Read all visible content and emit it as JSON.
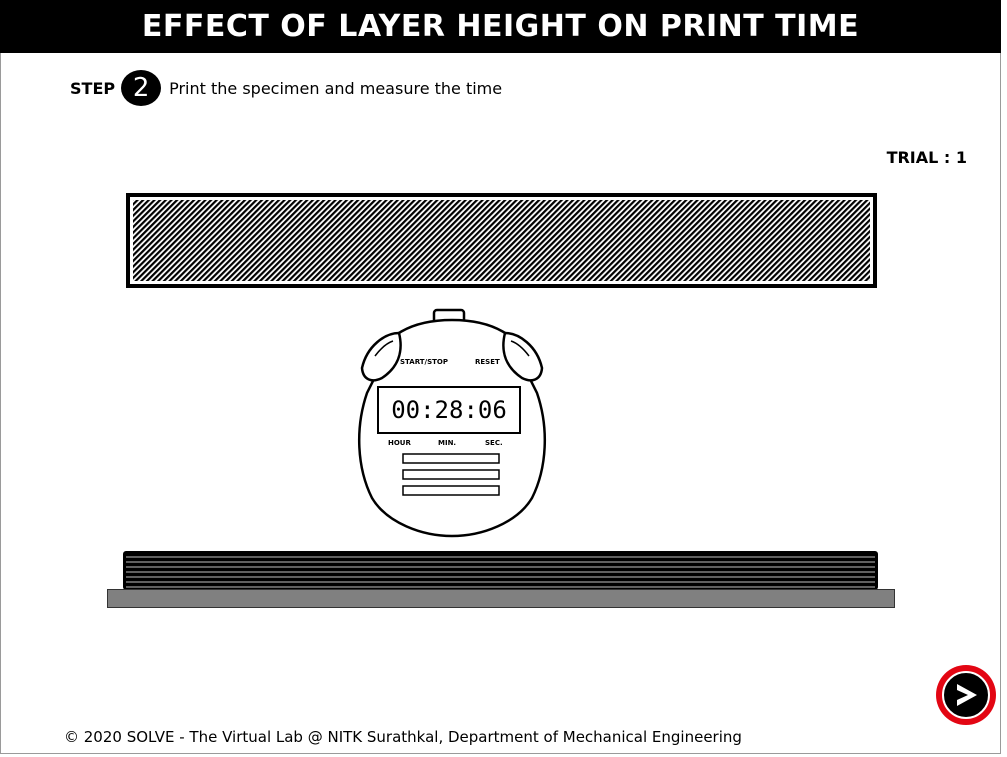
{
  "header": {
    "title": "EFFECT OF LAYER HEIGHT ON PRINT TIME"
  },
  "step": {
    "label": "STEP",
    "number": "2",
    "instruction": "Print the specimen and measure the time"
  },
  "trial": {
    "text": "TRIAL : 1"
  },
  "stopwatch": {
    "start_stop_label": "START/STOP",
    "reset_label": "RESET",
    "time": "00:28:06",
    "hour_label": "HOUR",
    "min_label": "MIN.",
    "sec_label": "SEC."
  },
  "footer": {
    "text": "© 2020 SOLVE - The Virtual Lab @ NITK Surathkal, Department of Mechanical Engineering"
  },
  "next_button": {
    "icon": "chevron-right-icon",
    "ring_color": "#e30613"
  }
}
